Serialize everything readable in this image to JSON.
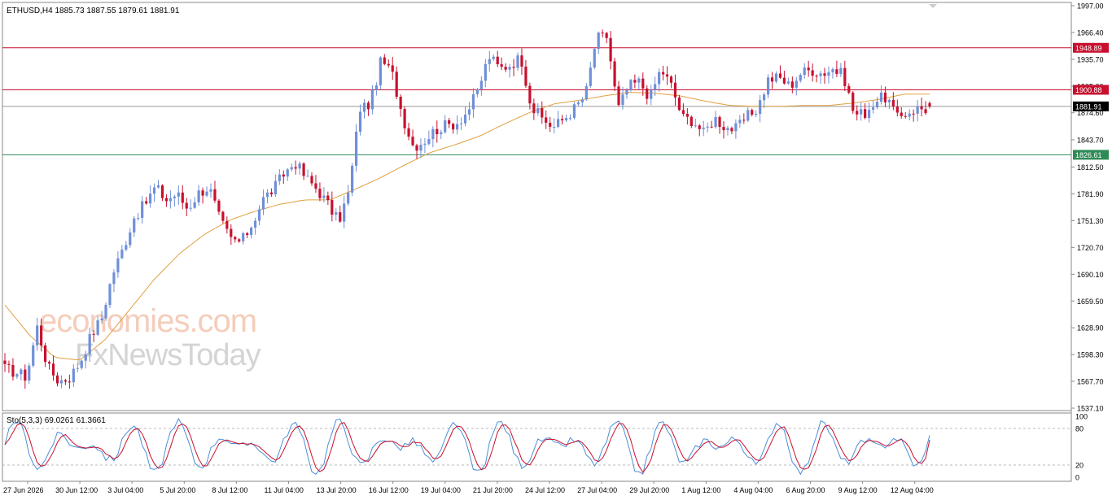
{
  "header": {
    "symbol_line": "ETHUSD,H4  1885.73 1887.55 1879.61 1881.91"
  },
  "watermark": {
    "line1": "economies.com",
    "line2": "FxNewsToday"
  },
  "indicator": {
    "label": "Sto(5,3,3) 69.0261 61.3661",
    "levels": [
      "100",
      "80",
      "20",
      "0"
    ]
  },
  "colors": {
    "bull": "#6f8fd8",
    "bear": "#c8102e",
    "ma": "#e0a040",
    "resistance": "#c8102e",
    "support": "#2e8b57",
    "current": "#999999",
    "stoch_main": "#4a90d9",
    "stoch_signal": "#c8102e"
  },
  "chart_data": {
    "type": "candlestick",
    "symbol": "ETHUSD",
    "timeframe": "H4",
    "ohlc_current": {
      "open": 1885.73,
      "high": 1887.55,
      "low": 1879.61,
      "close": 1881.91
    },
    "ylim": [
      1537.1,
      1997.0
    ],
    "y_ticks": [
      "1997.00",
      "1966.40",
      "1935.70",
      "1905.00",
      "1874.60",
      "1843.70",
      "1812.50",
      "1781.90",
      "1751.30",
      "1720.70",
      "1690.10",
      "1659.50",
      "1628.90",
      "1598.30",
      "1567.70",
      "1537.10"
    ],
    "x_ticks": [
      "27 Jun 2026",
      "30 Jun 12:00",
      "3 Jul 04:00",
      "5 Jul 20:00",
      "8 Jul 12:00",
      "11 Jul 04:00",
      "13 Jul 20:00",
      "16 Jul 12:00",
      "19 Jul 04:00",
      "21 Jul 20:00",
      "24 Jul 12:00",
      "27 Jul 04:00",
      "29 Jul 20:00",
      "1 Aug 12:00",
      "4 Aug 04:00",
      "6 Aug 20:00",
      "9 Aug 12:00",
      "12 Aug 04:00"
    ],
    "horizontal_levels": [
      {
        "label": "1948.89",
        "value": 1948.89,
        "kind": "resistance"
      },
      {
        "label": "1900.88",
        "value": 1900.88,
        "kind": "resistance"
      },
      {
        "label": "1881.91",
        "value": 1881.91,
        "kind": "current"
      },
      {
        "label": "1826.61",
        "value": 1826.61,
        "kind": "support"
      }
    ],
    "close_anchors": [
      1582,
      1578,
      1573,
      1630,
      1584,
      1568,
      1572,
      1590,
      1620,
      1640,
      1690,
      1720,
      1755,
      1770,
      1790,
      1775,
      1782,
      1765,
      1783,
      1790,
      1752,
      1730,
      1727,
      1748,
      1776,
      1788,
      1806,
      1818,
      1800,
      1788,
      1771,
      1750,
      1784,
      1880,
      1885,
      1935,
      1920,
      1870,
      1836,
      1843,
      1855,
      1860,
      1863,
      1876,
      1900,
      1940,
      1925,
      1930,
      1938,
      1880,
      1868,
      1858,
      1868,
      1880,
      1895,
      1960,
      1962,
      1878,
      1905,
      1910,
      1892,
      1925,
      1905,
      1869,
      1866,
      1851,
      1869,
      1858,
      1856,
      1870,
      1880,
      1913,
      1915,
      1905,
      1920,
      1924,
      1920,
      1925,
      1917,
      1872,
      1875,
      1889,
      1893,
      1868,
      1876,
      1880,
      1878
    ],
    "ma_anchors": [
      1655,
      1620,
      1595,
      1592,
      1615,
      1650,
      1685,
      1714,
      1736,
      1752,
      1762,
      1770,
      1775,
      1775,
      1787,
      1800,
      1815,
      1829,
      1838,
      1848,
      1862,
      1875,
      1885,
      1889,
      1894,
      1898,
      1897,
      1894,
      1888,
      1883,
      1882,
      1882,
      1883,
      1883,
      1886,
      1890,
      1896,
      1896
    ],
    "stochastic": {
      "k_period": 5,
      "d_period": 3,
      "slowing": 3,
      "last_main": 69.0261,
      "last_signal": 61.3661,
      "upper_level": 80,
      "lower_level": 20,
      "ylim": [
        0,
        100
      ]
    }
  }
}
